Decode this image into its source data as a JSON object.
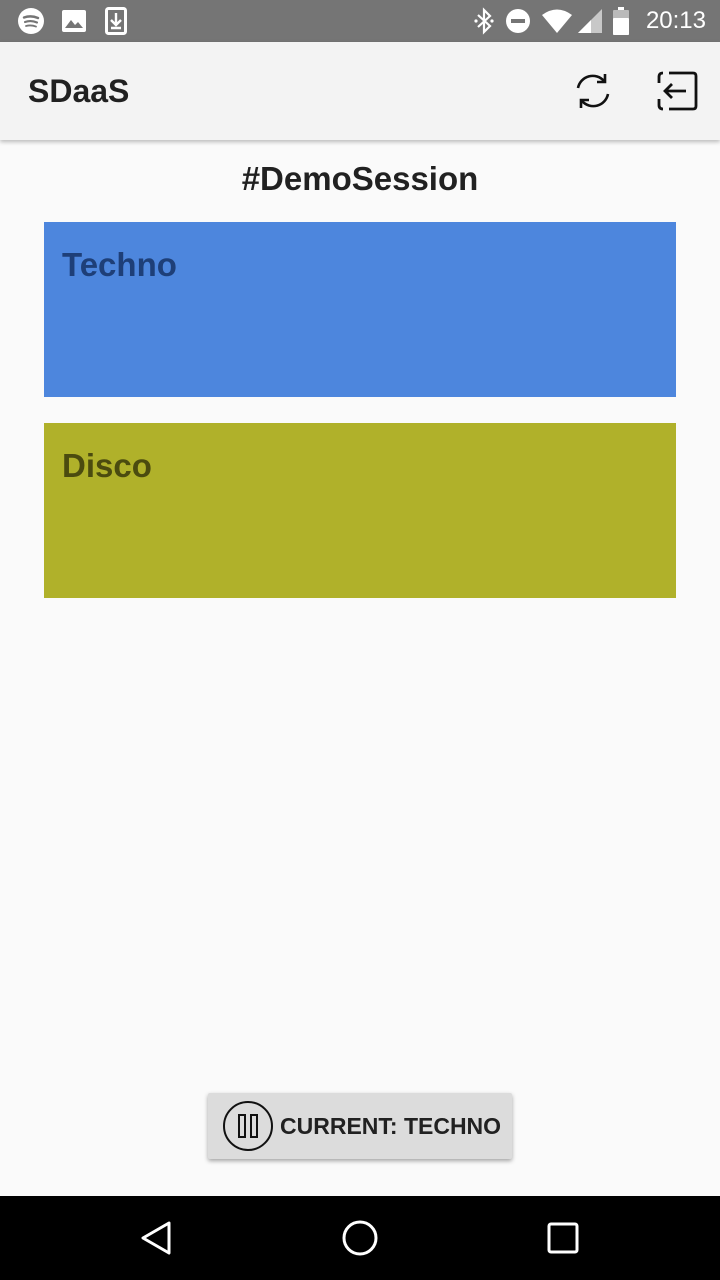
{
  "status_bar": {
    "time": "20:13",
    "left_icons": [
      "spotify-icon",
      "image-icon",
      "download-icon"
    ],
    "right_icons": [
      "bluetooth-icon",
      "do-not-disturb-icon",
      "wifi-icon",
      "signal-icon",
      "battery-icon"
    ]
  },
  "app_bar": {
    "title": "SDaaS",
    "actions": [
      "refresh-icon",
      "logout-icon"
    ]
  },
  "session": {
    "title": "#DemoSession"
  },
  "genres": [
    {
      "label": "Techno",
      "bg_color": "#4d86dd",
      "text_color": "#1e3f78"
    },
    {
      "label": "Disco",
      "bg_color": "#b0b12a",
      "text_color": "#4b4b0f"
    }
  ],
  "player": {
    "label": "CURRENT: TECHNO",
    "icon": "pause-icon"
  },
  "nav_bar": {
    "buttons": [
      "back-icon",
      "home-icon",
      "recents-icon"
    ]
  }
}
